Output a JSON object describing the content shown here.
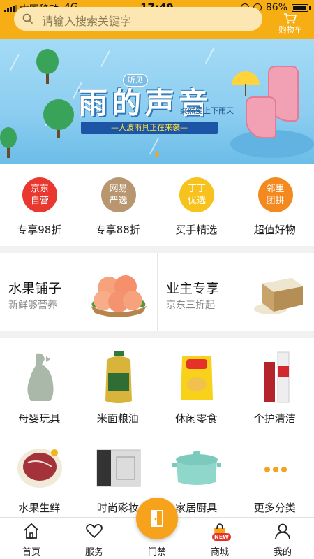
{
  "status_bar": {
    "carrier": "中国移动",
    "network": "4G",
    "time": "17:49",
    "battery": "86%"
  },
  "search": {
    "placeholder": "请输入搜索关键字",
    "cart_label": "购物车"
  },
  "banner": {
    "small_tag": "听见",
    "title": "雨的声音",
    "subtitle": "突然爱上下雨天",
    "ribbon": "—大波雨具正在来袭—",
    "page_count": 1,
    "active_index": 0
  },
  "quick_entries": [
    {
      "badge": "京东\n自营",
      "label": "专享98折",
      "color": "#e8382f"
    },
    {
      "badge": "网易\n严选",
      "label": "专享88折",
      "color": "#b89770"
    },
    {
      "badge": "丁丁\n优选",
      "label": "买手精选",
      "color": "#f7c21c"
    },
    {
      "badge": "邻里\n团拼",
      "label": "超值好物",
      "color": "#f48a1f"
    }
  ],
  "promos": [
    {
      "title": "水果铺子",
      "subtitle": "新鲜够营养",
      "image_icon": "peach-basket-icon"
    },
    {
      "title": "业主专享",
      "subtitle": "京东三折起",
      "image_icon": "rice-box-icon"
    }
  ],
  "categories": [
    {
      "label": "母婴玩具",
      "icon": "dinosaur-toy-icon"
    },
    {
      "label": "米面粮油",
      "icon": "oil-bottle-icon"
    },
    {
      "label": "休闲零食",
      "icon": "chips-bag-icon"
    },
    {
      "label": "个护清洁",
      "icon": "skincare-bottle-icon"
    },
    {
      "label": "水果生鲜",
      "icon": "meat-icon"
    },
    {
      "label": "时尚彩妆",
      "icon": "makeup-box-icon"
    },
    {
      "label": "家居厨具",
      "icon": "pot-icon"
    },
    {
      "label": "更多分类",
      "icon": "more-dots-icon"
    }
  ],
  "tabbar": {
    "items": [
      {
        "label": "首页",
        "icon": "home-icon"
      },
      {
        "label": "服务",
        "icon": "heart-icon"
      },
      {
        "label": "门禁",
        "icon": "door-icon"
      },
      {
        "label": "商城",
        "icon": "shopping-bag-icon",
        "badge": "NEW"
      },
      {
        "label": "我的",
        "icon": "user-icon"
      }
    ]
  },
  "colors": {
    "accent": "#f7ae14",
    "fab": "#f7a21b",
    "badge_new": "#e4322b"
  }
}
